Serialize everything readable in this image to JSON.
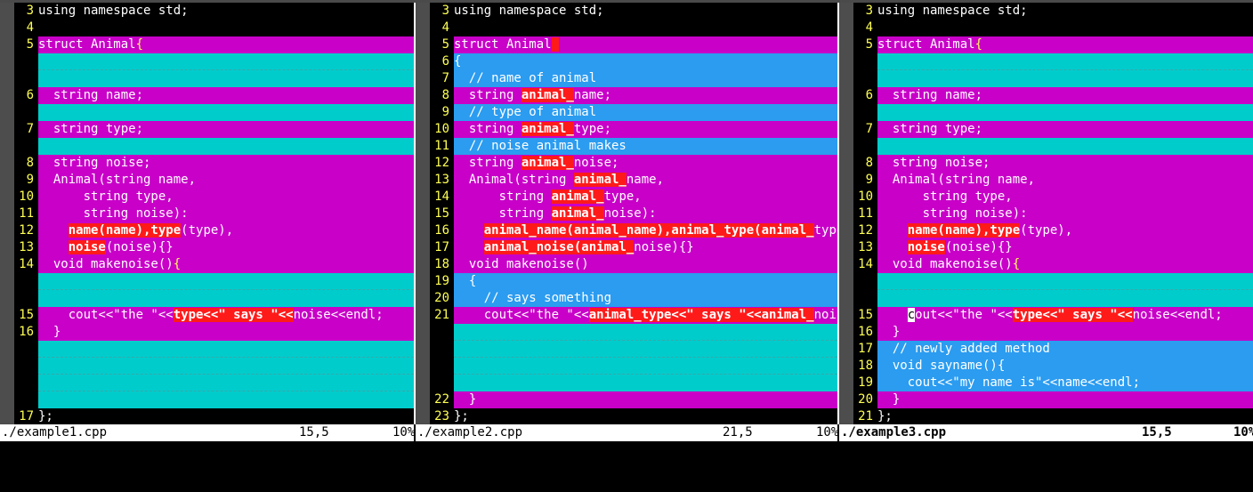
{
  "panes": [
    {
      "id": "pane1",
      "lines": [
        {
          "num": "3",
          "kind": "plain",
          "segs": [
            {
              "t": "using namespace std;"
            }
          ]
        },
        {
          "num": "4",
          "kind": "plain",
          "segs": [
            {
              "t": ""
            }
          ]
        },
        {
          "num": "5",
          "kind": "change",
          "segs": [
            {
              "t": "struct Animal"
            },
            {
              "t": "{",
              "c": "br"
            }
          ]
        },
        {
          "num": "",
          "kind": "filler",
          "segs": []
        },
        {
          "num": "",
          "kind": "filler",
          "segs": []
        },
        {
          "num": "6",
          "kind": "change",
          "segs": [
            {
              "t": "  string name;"
            }
          ]
        },
        {
          "num": "",
          "kind": "filler",
          "segs": []
        },
        {
          "num": "7",
          "kind": "change",
          "segs": [
            {
              "t": "  string type;"
            }
          ]
        },
        {
          "num": "",
          "kind": "filler",
          "segs": []
        },
        {
          "num": "8",
          "kind": "change",
          "segs": [
            {
              "t": "  string noise;"
            }
          ]
        },
        {
          "num": "9",
          "kind": "change",
          "segs": [
            {
              "t": "  Animal(string name,"
            }
          ]
        },
        {
          "num": "10",
          "kind": "change",
          "segs": [
            {
              "t": "      string type,"
            }
          ]
        },
        {
          "num": "11",
          "kind": "change",
          "segs": [
            {
              "t": "      string noise):"
            }
          ]
        },
        {
          "num": "12",
          "kind": "change",
          "segs": [
            {
              "t": "    "
            },
            {
              "t": "name(name),type",
              "c": "hl"
            },
            {
              "t": "(type),"
            }
          ]
        },
        {
          "num": "13",
          "kind": "change",
          "segs": [
            {
              "t": "    "
            },
            {
              "t": "noise",
              "c": "hl"
            },
            {
              "t": "(noise){}"
            }
          ]
        },
        {
          "num": "14",
          "kind": "change",
          "segs": [
            {
              "t": "  void makenoise()"
            },
            {
              "t": "{",
              "c": "br"
            }
          ]
        },
        {
          "num": "",
          "kind": "filler",
          "segs": []
        },
        {
          "num": "",
          "kind": "filler",
          "segs": []
        },
        {
          "num": "15",
          "kind": "change",
          "segs": [
            {
              "t": "    cout<<\"the \"<<"
            },
            {
              "t": "type<<\" says \"<<",
              "c": "hl"
            },
            {
              "t": "noise<<endl;"
            }
          ]
        },
        {
          "num": "16",
          "kind": "change",
          "segs": [
            {
              "t": "  }"
            }
          ]
        },
        {
          "num": "",
          "kind": "filler",
          "segs": []
        },
        {
          "num": "",
          "kind": "filler",
          "segs": []
        },
        {
          "num": "",
          "kind": "filler",
          "segs": []
        },
        {
          "num": "",
          "kind": "filler",
          "segs": []
        },
        {
          "num": "17",
          "kind": "plain",
          "segs": [
            {
              "t": "};"
            }
          ]
        }
      ],
      "status": {
        "file": "./example1.cpp",
        "pos": "15,5",
        "pct": "10%"
      }
    },
    {
      "id": "pane2",
      "lines": [
        {
          "num": "3",
          "kind": "plain",
          "segs": [
            {
              "t": "using namespace std;"
            }
          ]
        },
        {
          "num": "4",
          "kind": "plain",
          "segs": [
            {
              "t": ""
            }
          ]
        },
        {
          "num": "5",
          "kind": "change",
          "segs": [
            {
              "t": "struct Animal"
            },
            {
              "t": " ",
              "c": "hl"
            }
          ]
        },
        {
          "num": "6",
          "kind": "add",
          "segs": [
            {
              "t": "{"
            }
          ]
        },
        {
          "num": "7",
          "kind": "add",
          "segs": [
            {
              "t": "  // name of animal"
            }
          ]
        },
        {
          "num": "8",
          "kind": "change",
          "segs": [
            {
              "t": "  string "
            },
            {
              "t": "animal_",
              "c": "hl"
            },
            {
              "t": "name;"
            }
          ]
        },
        {
          "num": "9",
          "kind": "add",
          "segs": [
            {
              "t": "  // type of animal"
            }
          ]
        },
        {
          "num": "10",
          "kind": "change",
          "segs": [
            {
              "t": "  string "
            },
            {
              "t": "animal_",
              "c": "hl"
            },
            {
              "t": "type;"
            }
          ]
        },
        {
          "num": "11",
          "kind": "add",
          "segs": [
            {
              "t": "  // noise animal makes"
            }
          ]
        },
        {
          "num": "12",
          "kind": "change",
          "segs": [
            {
              "t": "  string "
            },
            {
              "t": "animal_",
              "c": "hl"
            },
            {
              "t": "noise;"
            }
          ]
        },
        {
          "num": "13",
          "kind": "change",
          "segs": [
            {
              "t": "  Animal(string "
            },
            {
              "t": "animal_",
              "c": "hl"
            },
            {
              "t": "name,"
            }
          ]
        },
        {
          "num": "14",
          "kind": "change",
          "segs": [
            {
              "t": "      string "
            },
            {
              "t": "animal_",
              "c": "hl"
            },
            {
              "t": "type,"
            }
          ]
        },
        {
          "num": "15",
          "kind": "change",
          "segs": [
            {
              "t": "      string "
            },
            {
              "t": "animal_",
              "c": "hl"
            },
            {
              "t": "noise):"
            }
          ]
        },
        {
          "num": "16",
          "kind": "change",
          "segs": [
            {
              "t": "    "
            },
            {
              "t": "animal_name(animal_name),animal_type(animal_",
              "c": "hl"
            },
            {
              "t": "type),"
            }
          ]
        },
        {
          "num": "17",
          "kind": "change",
          "segs": [
            {
              "t": "    "
            },
            {
              "t": "animal_noise(animal_",
              "c": "hl"
            },
            {
              "t": "noise){}"
            }
          ]
        },
        {
          "num": "18",
          "kind": "change",
          "segs": [
            {
              "t": "  void makenoise()"
            }
          ]
        },
        {
          "num": "19",
          "kind": "add",
          "segs": [
            {
              "t": "  {"
            }
          ]
        },
        {
          "num": "20",
          "kind": "add",
          "segs": [
            {
              "t": "    // says something"
            }
          ]
        },
        {
          "num": "21",
          "kind": "change",
          "segs": [
            {
              "t": "    cout<<\"the \"<<"
            },
            {
              "t": "animal_type<<\" says \"<<animal_",
              "c": "hl"
            },
            {
              "t": "noise<<endl;"
            }
          ]
        },
        {
          "num": "",
          "kind": "filler",
          "segs": []
        },
        {
          "num": "",
          "kind": "filler",
          "segs": []
        },
        {
          "num": "",
          "kind": "filler",
          "segs": []
        },
        {
          "num": "",
          "kind": "filler",
          "segs": []
        },
        {
          "num": "22",
          "kind": "change",
          "segs": [
            {
              "t": "  }"
            }
          ]
        },
        {
          "num": "23",
          "kind": "plain",
          "segs": [
            {
              "t": "};"
            }
          ]
        }
      ],
      "status": {
        "file": "./example2.cpp",
        "pos": "21,5",
        "pct": "10%"
      }
    },
    {
      "id": "pane3",
      "lines": [
        {
          "num": "3",
          "kind": "plain",
          "segs": [
            {
              "t": "using namespace std;"
            }
          ]
        },
        {
          "num": "4",
          "kind": "plain",
          "segs": [
            {
              "t": ""
            }
          ]
        },
        {
          "num": "5",
          "kind": "change",
          "segs": [
            {
              "t": "struct Animal"
            },
            {
              "t": "{",
              "c": "br"
            }
          ]
        },
        {
          "num": "",
          "kind": "filler",
          "segs": []
        },
        {
          "num": "",
          "kind": "filler",
          "segs": []
        },
        {
          "num": "6",
          "kind": "change",
          "segs": [
            {
              "t": "  string name;"
            }
          ]
        },
        {
          "num": "",
          "kind": "filler",
          "segs": []
        },
        {
          "num": "7",
          "kind": "change",
          "segs": [
            {
              "t": "  string type;"
            }
          ]
        },
        {
          "num": "",
          "kind": "filler",
          "segs": []
        },
        {
          "num": "8",
          "kind": "change",
          "segs": [
            {
              "t": "  string noise;"
            }
          ]
        },
        {
          "num": "9",
          "kind": "change",
          "segs": [
            {
              "t": "  Animal(string name,"
            }
          ]
        },
        {
          "num": "10",
          "kind": "change",
          "segs": [
            {
              "t": "      string type,"
            }
          ]
        },
        {
          "num": "11",
          "kind": "change",
          "segs": [
            {
              "t": "      string noise):"
            }
          ]
        },
        {
          "num": "12",
          "kind": "change",
          "segs": [
            {
              "t": "    "
            },
            {
              "t": "name(name),type",
              "c": "hl"
            },
            {
              "t": "(type),"
            }
          ]
        },
        {
          "num": "13",
          "kind": "change",
          "segs": [
            {
              "t": "    "
            },
            {
              "t": "noise",
              "c": "hl"
            },
            {
              "t": "(noise){}"
            }
          ]
        },
        {
          "num": "14",
          "kind": "change",
          "segs": [
            {
              "t": "  void makenoise()"
            },
            {
              "t": "{",
              "c": "br"
            }
          ]
        },
        {
          "num": "",
          "kind": "filler",
          "segs": []
        },
        {
          "num": "",
          "kind": "filler",
          "segs": []
        },
        {
          "num": "15",
          "kind": "change",
          "segs": [
            {
              "t": "    "
            },
            {
              "t": "c",
              "c": "cursor"
            },
            {
              "t": "out<<\"the \"<<"
            },
            {
              "t": "type<<\" says \"<<",
              "c": "hl"
            },
            {
              "t": "noise<<endl;"
            }
          ]
        },
        {
          "num": "16",
          "kind": "change",
          "segs": [
            {
              "t": "  }"
            }
          ]
        },
        {
          "num": "17",
          "kind": "add",
          "segs": [
            {
              "t": "  // newly added method"
            }
          ]
        },
        {
          "num": "18",
          "kind": "add",
          "segs": [
            {
              "t": "  void sayname(){"
            }
          ]
        },
        {
          "num": "19",
          "kind": "add",
          "segs": [
            {
              "t": "    cout<<\"my name is\"<<name<<endl;"
            }
          ]
        },
        {
          "num": "20",
          "kind": "change",
          "segs": [
            {
              "t": "  }"
            }
          ]
        },
        {
          "num": "21",
          "kind": "plain",
          "segs": [
            {
              "t": "};"
            }
          ]
        }
      ],
      "status": {
        "file": "./example3.cpp",
        "pos": "15,5",
        "pct": "10%"
      }
    }
  ],
  "colors": {
    "changed_line": "#c800c8",
    "added_line": "#2b9cf0",
    "filler_line": "#00cccc",
    "changed_text": "#ff1a1a",
    "line_number": "#ffff55"
  }
}
